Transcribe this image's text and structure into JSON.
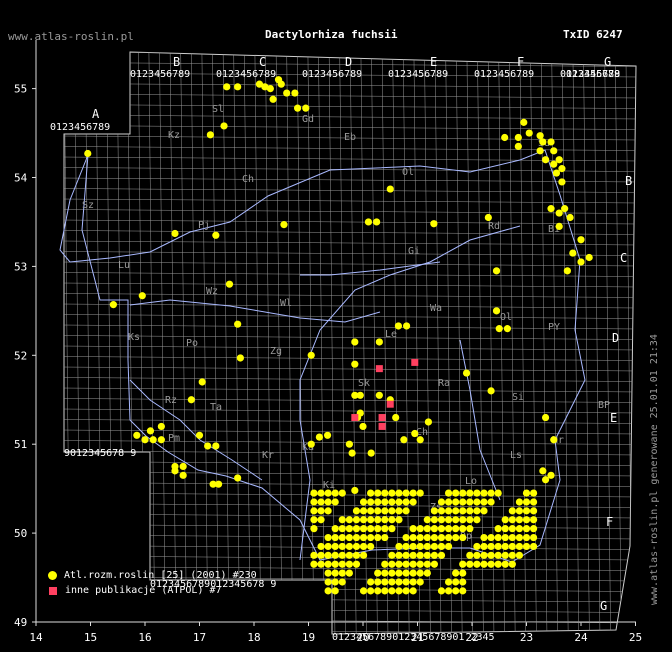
{
  "header": {
    "site": "www.atlas-roslin.pl",
    "title": "Dactylorhiza fuchsii",
    "taxid": "TxID 6247"
  },
  "side_note": "www.atlas-roslin.pl generowane 25.01.01 21:34",
  "legend": [
    {
      "symbol": "yellow-dot",
      "label": "Atl.rozm.roslin [25] (2001) #230",
      "color": "#ffff00"
    },
    {
      "symbol": "red-square",
      "label": "inne publikacje (ATPOL) #7",
      "color": "#ff4060"
    }
  ],
  "axes": {
    "x_ticks": [
      "14",
      "15",
      "16",
      "17",
      "18",
      "19",
      "20",
      "21",
      "22",
      "23",
      "24",
      "25"
    ],
    "y_ticks": [
      "49",
      "50",
      "51",
      "52",
      "53",
      "54",
      "55"
    ]
  },
  "grid_letters_top": [
    "A",
    "B",
    "C",
    "D",
    "E",
    "F",
    "G"
  ],
  "grid_letters_right": [
    "B",
    "C",
    "D",
    "E",
    "F",
    "G"
  ],
  "top_digits": [
    "0123456789",
    "0123456789",
    "0123456789",
    "0123456789",
    "0123456789",
    "0123456789",
    "012345678"
  ],
  "region_labels": [
    "Sz",
    "Kz",
    "Ch",
    "Pj",
    "Sl",
    "Gd",
    "Eb",
    "Ol",
    "Su",
    "Bi",
    "Gi",
    "Lu",
    "Wz",
    "Wl",
    "Ks",
    "Po",
    "Zg",
    "Le",
    "Wa",
    "Sk",
    "Ra",
    "PY",
    "Rd",
    "BP",
    "Si",
    "Ch",
    "Lo",
    "Op",
    "Ki",
    "Hr",
    "Kr",
    "Ta",
    "Rz",
    "Pm",
    "Ka",
    "Ol",
    "Zs",
    "Ls"
  ],
  "colors": {
    "occurrence": "#ffff00",
    "publication": "#ff4060",
    "grid": "#9a9a9a",
    "border": "#a9b9ff"
  },
  "map_data": {
    "extent_lon": [
      14,
      25
    ],
    "extent_lat": [
      49,
      55.6
    ],
    "yellow_points": [
      [
        14.95,
        54.27
      ],
      [
        15.42,
        52.57
      ],
      [
        15.95,
        52.67
      ],
      [
        16.55,
        53.37
      ],
      [
        17.2,
        54.48
      ],
      [
        17.45,
        54.58
      ],
      [
        17.0,
        51.1
      ],
      [
        17.3,
        53.35
      ],
      [
        17.55,
        52.8
      ],
      [
        17.7,
        52.35
      ],
      [
        17.75,
        51.97
      ],
      [
        17.05,
        51.7
      ],
      [
        16.85,
        51.5
      ],
      [
        16.1,
        51.15
      ],
      [
        16.3,
        51.2
      ],
      [
        15.85,
        51.1
      ],
      [
        16.0,
        51.05
      ],
      [
        16.15,
        51.05
      ],
      [
        16.3,
        51.05
      ],
      [
        16.55,
        50.75
      ],
      [
        16.7,
        50.75
      ],
      [
        16.55,
        50.7
      ],
      [
        16.7,
        50.65
      ],
      [
        17.25,
        50.55
      ],
      [
        17.35,
        50.55
      ],
      [
        17.15,
        50.98
      ],
      [
        17.3,
        50.98
      ],
      [
        17.7,
        50.62
      ],
      [
        17.5,
        55.02
      ],
      [
        17.7,
        55.02
      ],
      [
        18.1,
        55.05
      ],
      [
        18.2,
        55.02
      ],
      [
        18.3,
        55.0
      ],
      [
        18.45,
        55.1
      ],
      [
        18.35,
        54.88
      ],
      [
        18.5,
        55.05
      ],
      [
        18.6,
        54.95
      ],
      [
        18.75,
        54.95
      ],
      [
        18.8,
        54.78
      ],
      [
        18.95,
        54.78
      ],
      [
        18.55,
        53.47
      ],
      [
        19.05,
        51.0
      ],
      [
        19.2,
        51.08
      ],
      [
        19.35,
        51.1
      ],
      [
        19.05,
        52.0
      ],
      [
        19.85,
        51.55
      ],
      [
        19.95,
        51.55
      ],
      [
        19.85,
        52.15
      ],
      [
        19.85,
        51.9
      ],
      [
        19.75,
        51.0
      ],
      [
        19.8,
        50.9
      ],
      [
        19.9,
        51.3
      ],
      [
        19.95,
        51.35
      ],
      [
        19.85,
        50.48
      ],
      [
        20.0,
        51.2
      ],
      [
        20.1,
        53.5
      ],
      [
        20.25,
        53.5
      ],
      [
        20.5,
        53.87
      ],
      [
        20.3,
        52.15
      ],
      [
        20.65,
        52.33
      ],
      [
        20.8,
        52.33
      ],
      [
        20.3,
        51.55
      ],
      [
        20.5,
        51.5
      ],
      [
        20.6,
        51.3
      ],
      [
        20.75,
        51.05
      ],
      [
        20.95,
        51.12
      ],
      [
        20.15,
        50.9
      ],
      [
        21.05,
        51.05
      ],
      [
        21.2,
        51.25
      ],
      [
        21.3,
        53.48
      ],
      [
        22.3,
        53.55
      ],
      [
        22.45,
        52.95
      ],
      [
        22.5,
        52.3
      ],
      [
        22.65,
        52.3
      ],
      [
        22.45,
        52.5
      ],
      [
        22.35,
        51.6
      ],
      [
        22.6,
        54.45
      ],
      [
        22.85,
        54.45
      ],
      [
        22.85,
        54.35
      ],
      [
        22.95,
        54.62
      ],
      [
        23.05,
        54.5
      ],
      [
        23.25,
        54.47
      ],
      [
        23.3,
        54.4
      ],
      [
        23.45,
        54.4
      ],
      [
        23.5,
        54.3
      ],
      [
        23.35,
        54.2
      ],
      [
        23.5,
        54.15
      ],
      [
        23.6,
        54.2
      ],
      [
        23.65,
        54.1
      ],
      [
        23.55,
        54.05
      ],
      [
        23.65,
        53.95
      ],
      [
        23.25,
        54.3
      ],
      [
        23.45,
        53.65
      ],
      [
        23.6,
        53.6
      ],
      [
        23.8,
        53.55
      ],
      [
        23.7,
        53.65
      ],
      [
        23.6,
        53.45
      ],
      [
        24.0,
        53.3
      ],
      [
        23.85,
        53.15
      ],
      [
        24.0,
        53.05
      ],
      [
        24.15,
        53.1
      ],
      [
        23.75,
        52.95
      ],
      [
        23.35,
        51.3
      ],
      [
        23.5,
        51.05
      ],
      [
        23.3,
        50.7
      ],
      [
        23.45,
        50.65
      ],
      [
        23.35,
        50.6
      ],
      [
        21.9,
        51.8
      ]
    ],
    "yellow_cluster_bbox": [
      19.1,
      49.35,
      23.15,
      50.5
    ],
    "red_points": [
      [
        20.3,
        51.85
      ],
      [
        20.95,
        51.92
      ],
      [
        19.85,
        51.3
      ],
      [
        20.35,
        51.3
      ],
      [
        20.35,
        51.2
      ],
      [
        20.5,
        51.45
      ]
    ]
  }
}
